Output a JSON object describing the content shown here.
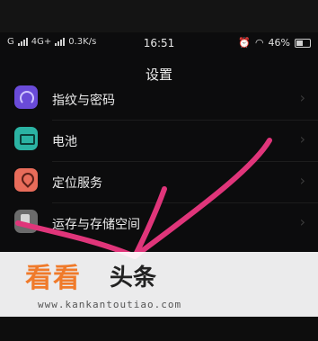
{
  "status_bar": {
    "signal_left": "G",
    "network": "4G+",
    "speed": "0.3K/s",
    "time": "16:51",
    "battery": "46%"
  },
  "header": {
    "title": "设置"
  },
  "settings": {
    "items": [
      {
        "label": "指纹与密码",
        "icon": "fingerprint-icon"
      },
      {
        "label": "电池",
        "icon": "battery-icon"
      },
      {
        "label": "定位服务",
        "icon": "location-icon"
      },
      {
        "label": "运存与存储空间",
        "icon": "storage-icon"
      }
    ]
  },
  "watermark": {
    "brand_a": "看看",
    "brand_b": "头条",
    "url": "www.kankantoutiao.com"
  },
  "colors": {
    "accent_arrow": "#e0357a",
    "brand_orange": "#f07a2a"
  }
}
